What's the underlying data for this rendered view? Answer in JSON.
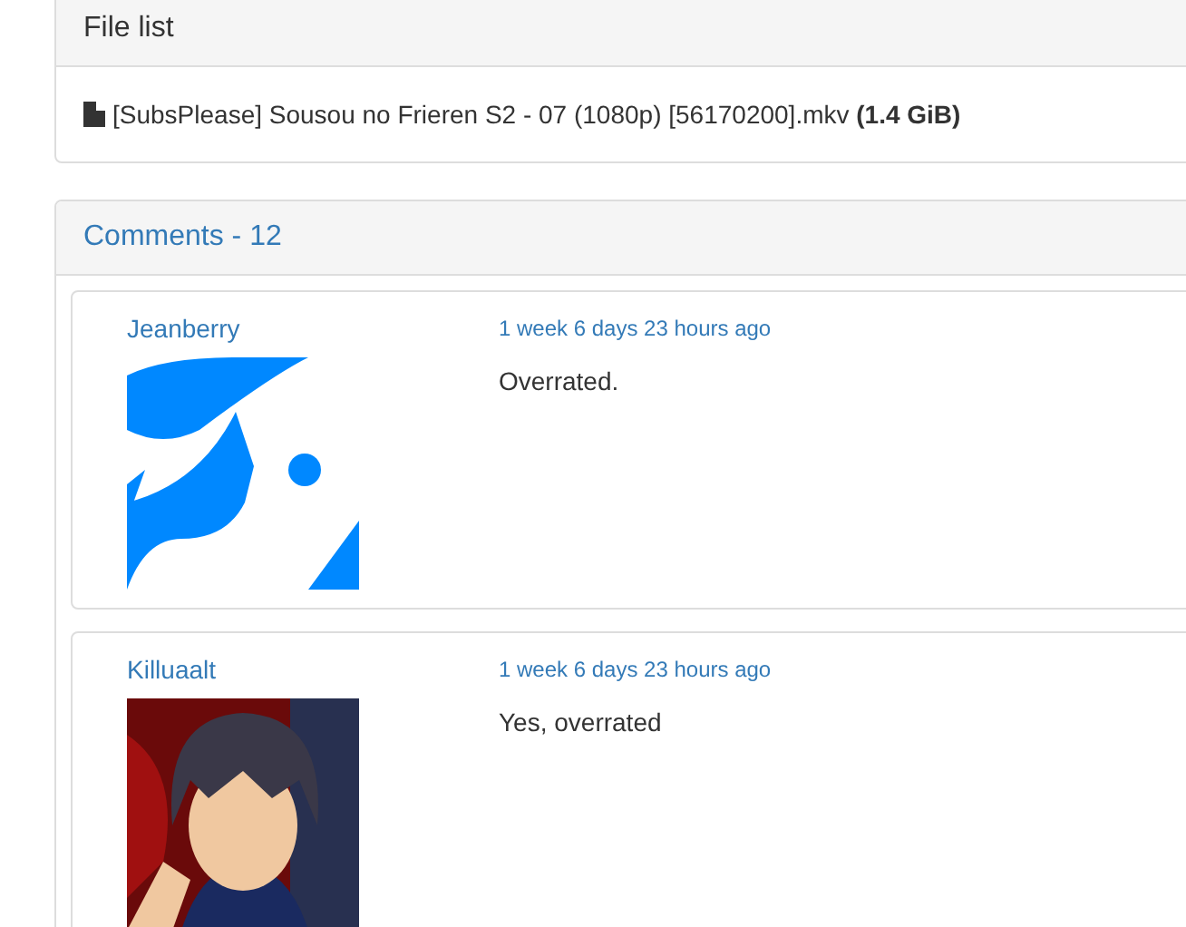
{
  "file_list": {
    "title": "File list",
    "files": [
      {
        "name": "[SubsPlease] Sousou no Frieren S2 - 07 (1080p) [56170200].mkv",
        "size": "(1.4 GiB)"
      }
    ]
  },
  "comments": {
    "title": "Comments - 12",
    "items": [
      {
        "user": "Jeanberry",
        "time": "1 week 6 days 23 hours ago",
        "text": "Overrated."
      },
      {
        "user": "Killuaalt",
        "time": "1 week 6 days 23 hours ago",
        "text": "Yes, overrated"
      }
    ]
  }
}
